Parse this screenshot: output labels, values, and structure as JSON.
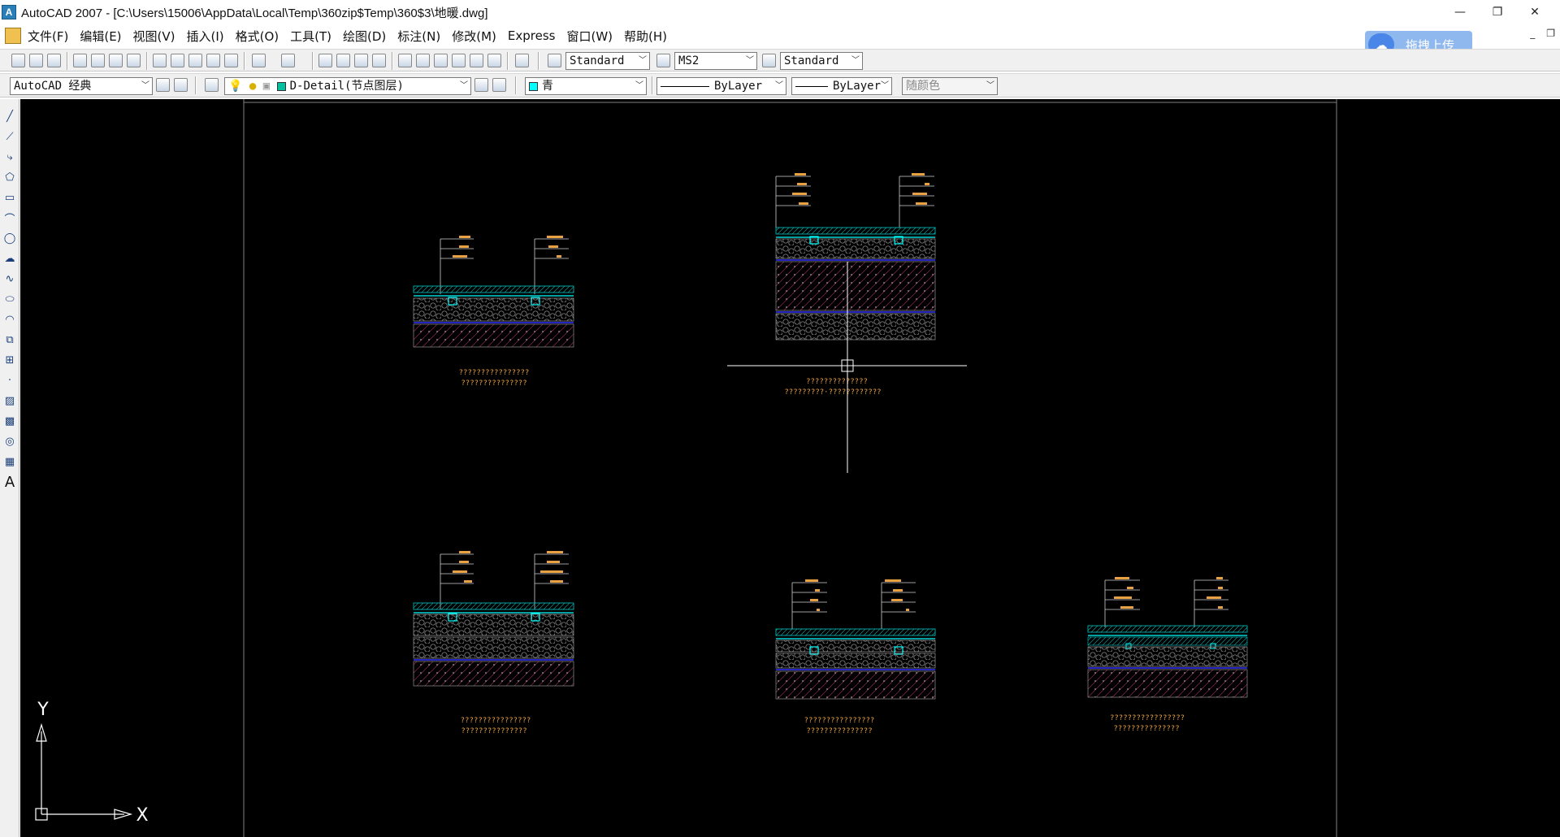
{
  "window": {
    "title": "AutoCAD 2007 - [C:\\Users\\15006\\AppData\\Local\\Temp\\360zip$Temp\\360$3\\地暖.dwg]",
    "app_icon": "autocad-logo-icon",
    "minimize_label": "—",
    "maximize_label": "❐",
    "close_label": "✕"
  },
  "menubar": {
    "items": [
      "文件(F)",
      "编辑(E)",
      "视图(V)",
      "插入(I)",
      "格式(O)",
      "工具(T)",
      "绘图(D)",
      "标注(N)",
      "修改(M)",
      "Express",
      "窗口(W)",
      "帮助(H)"
    ],
    "mdi_min": "_",
    "mdi_restore": "❐"
  },
  "upload_badge": {
    "label": "拖拽上传",
    "icon": "cloud-icon"
  },
  "toolbar1": {
    "text_style": "Standard",
    "dim_style": "MS2",
    "table_style": "Standard"
  },
  "toolbar2": {
    "workspace": "AutoCAD 经典",
    "layer": "D-Detail(节点图层)",
    "color": "青",
    "color_hex": "#00ffff",
    "linetype": "ByLayer",
    "lineweight": "ByLayer",
    "plotstyle": "随颜色"
  },
  "left_toolbar": {
    "icons": [
      "line-icon",
      "construction-line-icon",
      "polyline-icon",
      "polygon-icon",
      "rectangle-icon",
      "arc-icon",
      "circle-icon",
      "revision-cloud-icon",
      "spline-icon",
      "ellipse-icon",
      "ellipse-arc-icon",
      "insert-block-icon",
      "make-block-icon",
      "point-icon",
      "hatch-icon",
      "gradient-icon",
      "region-icon",
      "table-icon",
      "multiline-text-icon"
    ],
    "text_glyph": "A"
  },
  "drawing": {
    "ucs_x_label": "X",
    "ucs_y_label": "Y",
    "background": "#000000",
    "layer_color": "#00ffff",
    "annotation_color": "#e8a040",
    "details": [
      {
        "id": "detail-1",
        "caption1": "????????????????",
        "caption2": "???????????????"
      },
      {
        "id": "detail-2",
        "caption1": "??????????????",
        "caption2": "?????????·????????????"
      },
      {
        "id": "detail-3",
        "caption1": "????????????????",
        "caption2": "???????????????"
      },
      {
        "id": "detail-4",
        "caption1": "????????????????",
        "caption2": "???????????????"
      },
      {
        "id": "detail-5",
        "caption1": "?????????????????",
        "caption2": "???????????????"
      }
    ]
  }
}
